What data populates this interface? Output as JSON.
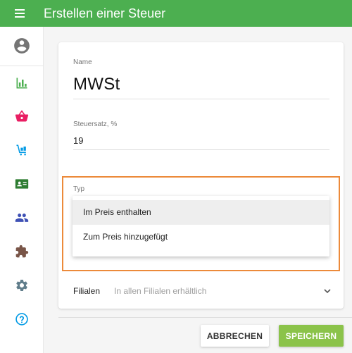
{
  "header": {
    "title": "Erstellen einer Steuer",
    "menu_icon": "hamburger-menu-icon"
  },
  "sidebar": {
    "items": [
      {
        "name": "account",
        "icon": "account-circle-icon",
        "color": "#757575"
      },
      {
        "name": "reports",
        "icon": "bar-chart-icon",
        "color": "#4caf50"
      },
      {
        "name": "sales",
        "icon": "basket-icon",
        "color": "#e91e63"
      },
      {
        "name": "inventory",
        "icon": "cart-boxes-icon",
        "color": "#039be5"
      },
      {
        "name": "customers",
        "icon": "contact-card-icon",
        "color": "#2e7d32"
      },
      {
        "name": "employees",
        "icon": "people-icon",
        "color": "#3f51b5"
      },
      {
        "name": "add-ons",
        "icon": "puzzle-icon",
        "color": "#795548"
      },
      {
        "name": "settings",
        "icon": "gear-icon",
        "color": "#607d8b"
      },
      {
        "name": "help",
        "icon": "help-circle-icon",
        "color": "#039be5"
      }
    ]
  },
  "form": {
    "name_label": "Name",
    "name_value": "MWSt",
    "rate_label": "Steuersatz, %",
    "rate_value": "19",
    "type_label": "Typ",
    "type_options": [
      "Im Preis enthalten",
      "Zum Preis hinzugefügt"
    ],
    "type_highlighted_option": "Im Preis enthalten",
    "stores_label": "Filialen",
    "stores_value": "In allen Filialen erhältlich"
  },
  "actions": {
    "cancel_label": "ABBRECHEN",
    "save_label": "SPEICHERN"
  },
  "colors": {
    "primary": "#4caf50",
    "save_button": "#8bc34a",
    "highlight_border": "#ec8a3a"
  }
}
